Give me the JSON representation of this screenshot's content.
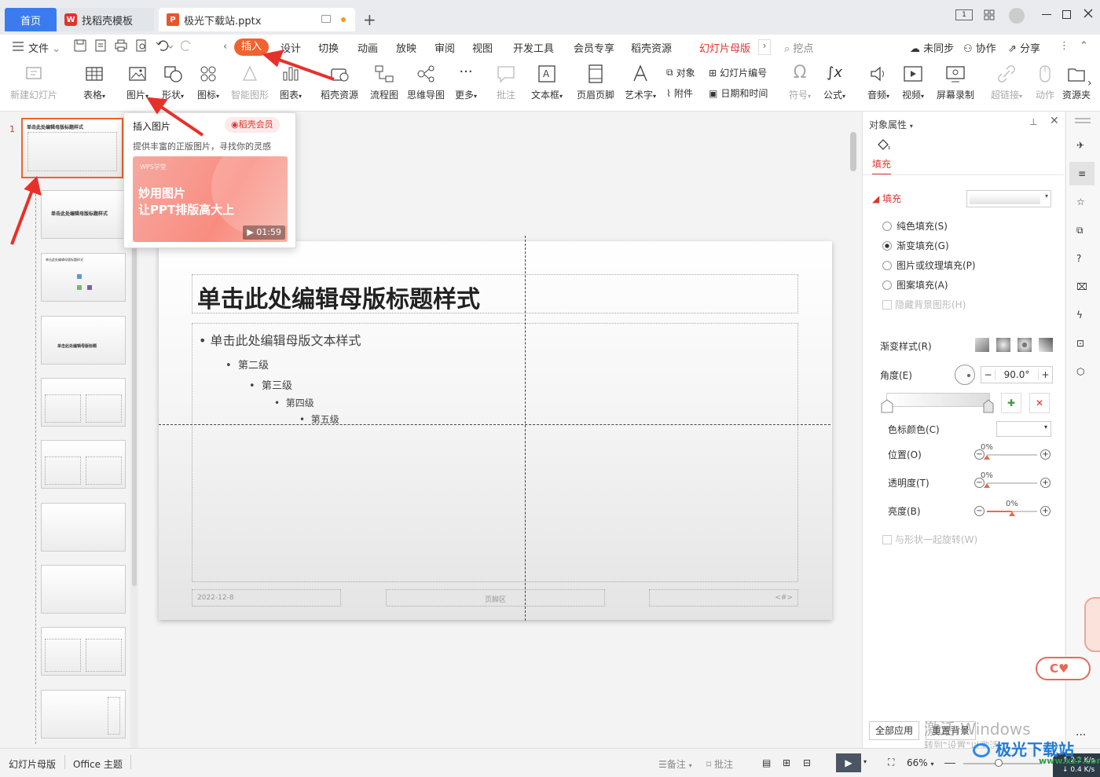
{
  "tabs": {
    "home": "首页",
    "template": "找稻壳模板",
    "document": "极光下载站.pptx",
    "add": "+"
  },
  "window": {
    "page_indicator": "1"
  },
  "menu": {
    "file": "文件",
    "items": [
      "插入",
      "设计",
      "切换",
      "动画",
      "放映",
      "审阅",
      "视图",
      "开发工具",
      "会员专享",
      "稻壳资源",
      "幻灯片母版"
    ],
    "search": "挖点",
    "sync": "未同步",
    "collab": "协作",
    "share": "分享"
  },
  "ribbon": {
    "new_slide": "新建幻灯片",
    "table": "表格",
    "picture": "图片",
    "shape": "形状",
    "icon": "图标",
    "smart": "智能图形",
    "chart": "图表",
    "docer": "稻壳资源",
    "flow": "流程图",
    "mindmap": "思维导图",
    "more": "更多",
    "comment": "批注",
    "textbox": "文本框",
    "header_footer": "页眉页脚",
    "wordart": "艺术字",
    "object": "对象",
    "slide_num": "幻灯片编号",
    "attachment": "附件",
    "datetime": "日期和时间",
    "symbol": "符号",
    "formula": "公式",
    "audio": "音频",
    "video": "视频",
    "screen_rec": "屏幕录制",
    "hyperlink": "超链接",
    "action": "动作",
    "resource": "资源夹"
  },
  "popup": {
    "title": "插入图片",
    "badge": "稻壳会员",
    "desc": "提供丰富的正版图片，寻找你的灵感",
    "card_brand": "WPS学堂",
    "card_line1": "妙用图片",
    "card_line2": "让PPT排版高大上",
    "duration": "01:59"
  },
  "thumbs": {
    "number": "1",
    "main_title": "单击此处编辑母版标题样式",
    "t2": "单击此处编辑母版标题样式",
    "t3": "单击此处编辑母版标题样式",
    "t4": "单击此处编辑母版标题"
  },
  "slide": {
    "title": "单击此处编辑母版标题样式",
    "level1": "单击此处编辑母版文本样式",
    "level2": "第二级",
    "level3": "第三级",
    "level4": "第四级",
    "level5": "第五级",
    "date": "2022-12-8",
    "footer": "页脚区",
    "num": "<#>"
  },
  "panel": {
    "header": "对象属性",
    "tab_fill": "填充",
    "section": "填充",
    "solid": "纯色填充(S)",
    "gradient": "渐变填充(G)",
    "picture": "图片或纹理填充(P)",
    "pattern": "图案填充(A)",
    "hide_bg": "隐藏背景图形(H)",
    "grad_style": "渐变样式(R)",
    "angle": "角度(E)",
    "angle_value": "90.0°",
    "stop_color": "色标颜色(C)",
    "position": "位置(O)",
    "transparency": "透明度(T)",
    "brightness": "亮度(B)",
    "pos_val": "0%",
    "trans_val": "0%",
    "bright_val": "0%",
    "rotate": "与形状一起旋转(W)",
    "apply_all": "全部应用",
    "reset_bg": "重置背景"
  },
  "watermark": {
    "line1": "激活 Windows",
    "line2": "转到\"设置\"以激活",
    "site": "极光下载站",
    "site_url": "www.xz7.com"
  },
  "status": {
    "master": "幻灯片母版",
    "theme": "Office 主题",
    "notes": "备注",
    "comment": "批注",
    "zoom": "66%",
    "speed_up": "2.2",
    "speed_down": "0.4",
    "speed_unit": "K/s"
  },
  "colors": {
    "accent": "#3a7cf0",
    "insert_tab": "#f2622e",
    "arrow": "#e8302a",
    "master_tab": "#e0332f"
  }
}
